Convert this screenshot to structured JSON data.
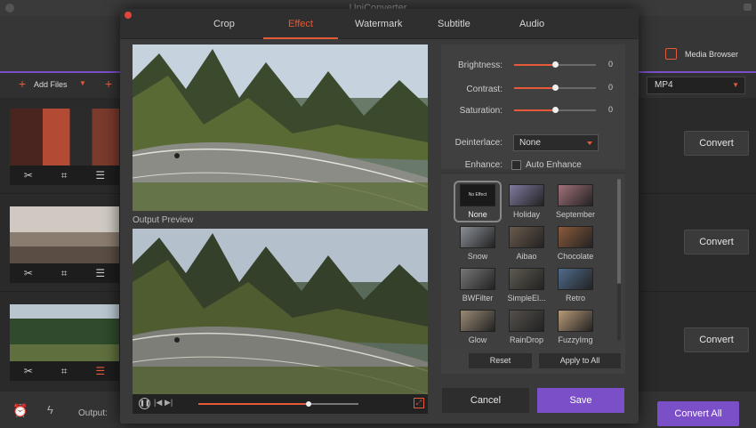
{
  "app": {
    "title": "UniConverter",
    "media_browser_label": "Media Browser",
    "add_files_label": "Add Files",
    "format_value": "MP4",
    "output_label": "Output:",
    "convert_label": "Convert",
    "convert_all_label": "Convert All"
  },
  "dialog": {
    "tabs": [
      "Crop",
      "Effect",
      "Watermark",
      "Subtitle",
      "Audio"
    ],
    "active_tab": "Effect",
    "output_preview_label": "Output Preview",
    "playback_progress": 0.69,
    "settings": {
      "brightness": {
        "label": "Brightness:",
        "value": "0",
        "level": 0.5
      },
      "contrast": {
        "label": "Contrast:",
        "value": "0",
        "level": 0.5
      },
      "saturation": {
        "label": "Saturation:",
        "value": "0",
        "level": 0.5
      },
      "deinterlace": {
        "label": "Deinterlace:",
        "value": "None"
      },
      "enhance": {
        "label": "Enhance:",
        "checkbox_label": "Auto Enhance",
        "checked": false
      }
    },
    "effects": [
      {
        "name": "None",
        "swatch": "#1a1a1a",
        "selected": true,
        "caption": "No Effect"
      },
      {
        "name": "Holiday",
        "swatch": "#7f7aa0"
      },
      {
        "name": "September",
        "swatch": "#a2707a"
      },
      {
        "name": "Snow",
        "swatch": "#8a8f96"
      },
      {
        "name": "Aibao",
        "swatch": "#6b5a4c"
      },
      {
        "name": "Chocolate",
        "swatch": "#8b5a3c"
      },
      {
        "name": "BWFilter",
        "swatch": "#777777"
      },
      {
        "name": "SimpleEl...",
        "swatch": "#5e5a50"
      },
      {
        "name": "Retro",
        "swatch": "#4f6b8c"
      },
      {
        "name": "Glow",
        "swatch": "#9a8a74"
      },
      {
        "name": "RainDrop",
        "swatch": "#54504a"
      },
      {
        "name": "FuzzyImg",
        "swatch": "#b89a78"
      }
    ],
    "reset_label": "Reset",
    "apply_to_all_label": "Apply to All",
    "cancel_label": "Cancel",
    "save_label": "Save"
  },
  "colors": {
    "accent_orange": "#e45a3a",
    "accent_purple": "#7b4fc8"
  }
}
